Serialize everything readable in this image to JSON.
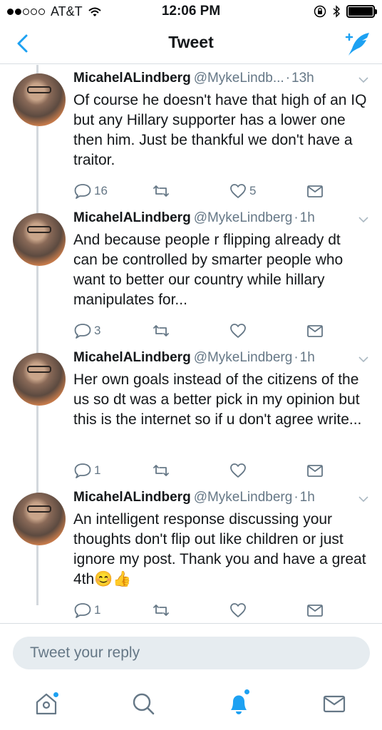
{
  "status_bar": {
    "carrier": "AT&T",
    "time": "12:06 PM"
  },
  "nav": {
    "title": "Tweet"
  },
  "tweets": [
    {
      "name": "MicahelALindberg",
      "handle": "@MykeLindb...",
      "time": "13h",
      "text": "Of course he doesn't have that high of an IQ but any Hillary supporter has a lower one then him. Just be thankful we don't have a traitor.",
      "replies": "16",
      "retweets": "",
      "likes": "5"
    },
    {
      "name": "MicahelALindberg",
      "handle": "@MykeLindberg",
      "time": "1h",
      "text": "And because people r flipping already dt can be controlled by smarter people who want to better our country while hillary manipulates for...",
      "replies": "3",
      "retweets": "",
      "likes": ""
    },
    {
      "name": "MicahelALindberg",
      "handle": "@MykeLindberg",
      "time": "1h",
      "text": "Her own goals instead of the citizens of the us so dt was a better pick in my opinion but this is the internet so if u don't agree write...",
      "replies": "1",
      "retweets": "",
      "likes": ""
    },
    {
      "name": "MicahelALindberg",
      "handle": "@MykeLindberg",
      "time": "1h",
      "text": "An intelligent response discussing your thoughts don't flip out like children or just ignore my post. Thank you and have a great 4th😊👍",
      "replies": "1",
      "retweets": "",
      "likes": ""
    }
  ],
  "reply": {
    "placeholder": "Tweet your reply"
  },
  "tabs": [
    "home-icon",
    "search-icon",
    "notifications-icon",
    "messages-icon"
  ],
  "colors": {
    "accent": "#1da1f2",
    "muted": "#657786",
    "text": "#14171a",
    "reply_bg": "#e6ecf0"
  }
}
